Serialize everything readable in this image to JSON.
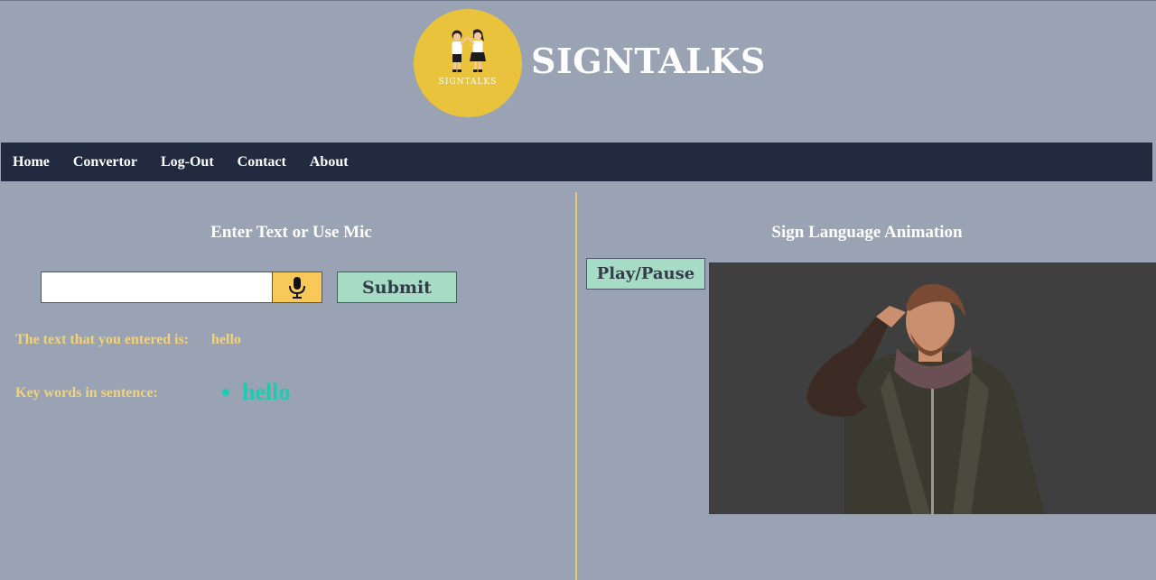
{
  "header": {
    "brand": "SIGNTALKS",
    "logo_text": "SIGNTALKS"
  },
  "nav": {
    "items": [
      "Home",
      "Convertor",
      "Log-Out",
      "Contact",
      "About"
    ]
  },
  "left": {
    "title": "Enter Text or Use Mic",
    "input_value": "",
    "mic_icon": "microphone-icon",
    "submit_label": "Submit",
    "entered_label": "The text that you entered is:",
    "entered_value": "hello",
    "keywords_label": "Key words in sentence:",
    "keywords": [
      "hello"
    ]
  },
  "right": {
    "title": "Sign Language Animation",
    "play_label": "Play/Pause"
  },
  "colors": {
    "background": "#99a3b4",
    "nav": "#222a40",
    "logo": "#e9c33b",
    "button": "#a6dcc6",
    "mic_button": "#f7c95a",
    "accent_text": "#f2d27a",
    "keyword": "#1fcab0"
  }
}
